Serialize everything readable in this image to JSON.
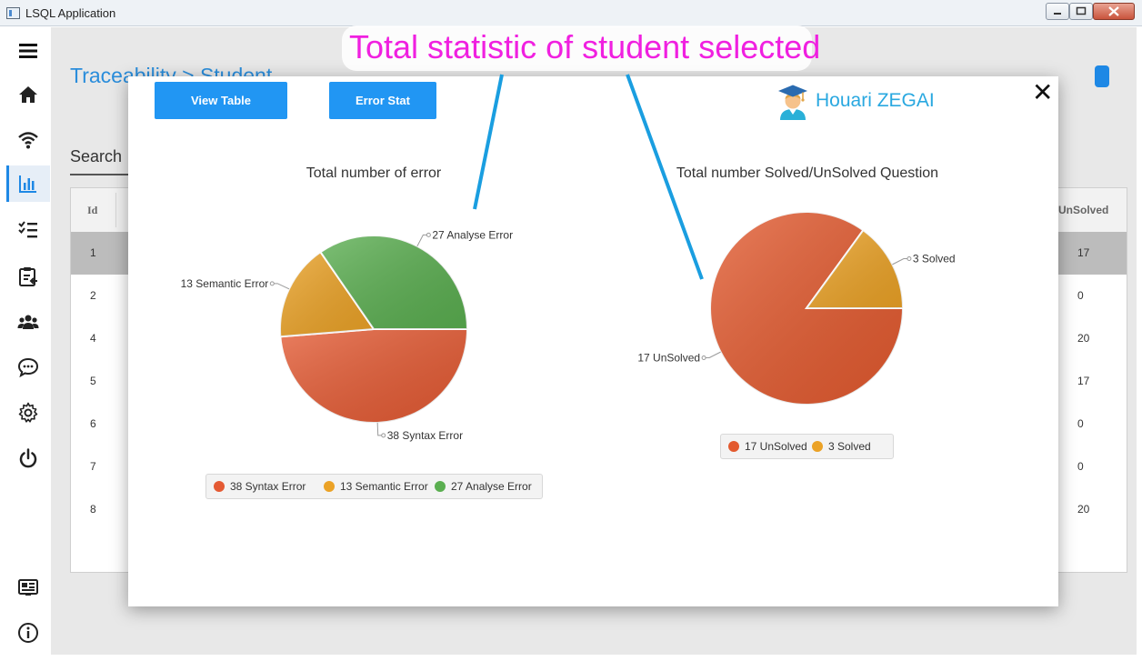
{
  "window": {
    "title": "LSQL Application"
  },
  "breadcrumb": "Traceability  >  Student",
  "search": {
    "label": "Search"
  },
  "table": {
    "id_header": "Id",
    "unsolved_header": "UnSolved",
    "rows": [
      {
        "id": "1",
        "unsolved": "17"
      },
      {
        "id": "2",
        "unsolved": "0"
      },
      {
        "id": "4",
        "unsolved": "20"
      },
      {
        "id": "5",
        "unsolved": "17"
      },
      {
        "id": "6",
        "unsolved": "0"
      },
      {
        "id": "7",
        "unsolved": "0"
      },
      {
        "id": "8",
        "unsolved": "20"
      }
    ]
  },
  "modal": {
    "view_table_button": "View Table",
    "error_stat_button": "Error Stat",
    "user_name": "Houari ZEGAI",
    "close": "✕"
  },
  "annotation": "Total statistic of student selected",
  "colors": {
    "accent": "#2196f3",
    "user": "#29a8e0",
    "annotation": "#f020e0",
    "syntax": "#e45a33",
    "semantic": "#eba226",
    "analyse": "#5aae50",
    "unsolved": "#e35a2f",
    "solved": "#eba226"
  },
  "chart_data": [
    {
      "type": "pie",
      "title": "Total number of error",
      "series": [
        {
          "name": "Syntax Error",
          "value": 38,
          "label": "38 Syntax Error",
          "color": "#e45a33"
        },
        {
          "name": "Semantic Error",
          "value": 13,
          "label": "13 Semantic Error",
          "color": "#eba226"
        },
        {
          "name": "Analyse Error",
          "value": 27,
          "label": "27 Analyse Error",
          "color": "#5aae50"
        }
      ],
      "legend": "bottom"
    },
    {
      "type": "pie",
      "title": "Total number Solved/UnSolved Question",
      "series": [
        {
          "name": "UnSolved",
          "value": 17,
          "label": "17 UnSolved",
          "color": "#e35a2f"
        },
        {
          "name": "Solved",
          "value": 3,
          "label": "3 Solved",
          "color": "#eba226"
        }
      ],
      "legend": "bottom"
    }
  ]
}
